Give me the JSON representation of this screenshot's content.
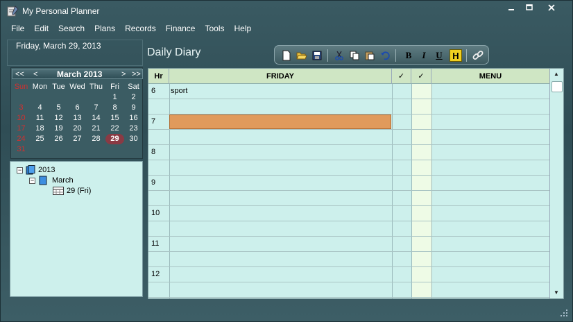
{
  "window": {
    "title": "My Personal Planner",
    "controls": [
      "minimize",
      "maximize",
      "close"
    ]
  },
  "menu": [
    "File",
    "Edit",
    "Search",
    "Plans",
    "Records",
    "Finance",
    "Tools",
    "Help"
  ],
  "left": {
    "current_date": "Friday, March 29, 2013",
    "calendar": {
      "nav_prev_year": "<<",
      "nav_prev_month": "<",
      "month_title": "March 2013",
      "nav_next_month": ">",
      "nav_next_year": ">>",
      "weekdays": [
        "Sun",
        "Mon",
        "Tue",
        "Wed",
        "Thu",
        "Fri",
        "Sat"
      ],
      "weeks": [
        [
          "",
          "",
          "",
          "",
          "",
          "1",
          "2"
        ],
        [
          "3",
          "4",
          "5",
          "6",
          "7",
          "8",
          "9"
        ],
        [
          "10",
          "11",
          "12",
          "13",
          "14",
          "15",
          "16"
        ],
        [
          "17",
          "18",
          "19",
          "20",
          "21",
          "22",
          "23"
        ],
        [
          "24",
          "25",
          "26",
          "27",
          "28",
          "29",
          "30"
        ],
        [
          "31",
          "",
          "",
          "",
          "",
          "",
          ""
        ]
      ],
      "selected_day": "29"
    },
    "tree": {
      "year": "2013",
      "month": "March",
      "day": "29 (Fri)"
    }
  },
  "main": {
    "title": "Daily Diary",
    "toolbar": [
      "new-icon",
      "open-icon",
      "save-icon",
      "cut-icon",
      "copy-icon",
      "paste-icon",
      "undo-icon",
      "bold-icon",
      "italic-icon",
      "underline-icon",
      "highlight-icon",
      "link-icon"
    ],
    "toolbar_letters": {
      "bold": "B",
      "italic": "I",
      "underline": "U",
      "highlight": "H"
    },
    "columns": {
      "hour": "Hr",
      "day": "FRIDAY",
      "check1": "✓",
      "check2": "✓",
      "menu": "MENU"
    },
    "rows": [
      {
        "hour": "6",
        "text": "sport"
      },
      {
        "hour": "",
        "text": ""
      },
      {
        "hour": "7",
        "text": ""
      },
      {
        "hour": "",
        "text": ""
      },
      {
        "hour": "8",
        "text": ""
      },
      {
        "hour": "",
        "text": ""
      },
      {
        "hour": "9",
        "text": ""
      },
      {
        "hour": "",
        "text": ""
      },
      {
        "hour": "10",
        "text": ""
      },
      {
        "hour": "",
        "text": ""
      },
      {
        "hour": "11",
        "text": ""
      },
      {
        "hour": "",
        "text": ""
      },
      {
        "hour": "12",
        "text": ""
      },
      {
        "hour": "",
        "text": ""
      }
    ],
    "selected_row": 2
  },
  "colors": {
    "background": "#2f4d55",
    "grid": "#cdf0ec",
    "header": "#cfe6c4",
    "selection": "#e09a5c",
    "today": "#8a3a44",
    "sunday": "#d03030"
  }
}
